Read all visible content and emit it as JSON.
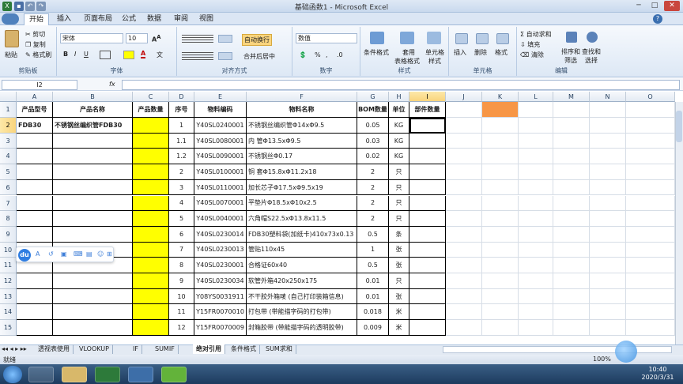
{
  "window": {
    "title": "基础函数1 - Microsoft Excel"
  },
  "ribbon": {
    "tabs": [
      "开始",
      "插入",
      "页面布局",
      "公式",
      "数据",
      "审阅",
      "视图"
    ],
    "active_tab": "开始",
    "clipboard": {
      "paste": "粘贴",
      "cut": "剪切",
      "copy": "复制",
      "format_painter": "格式刷",
      "label": "剪贴板"
    },
    "font": {
      "name": "宋体",
      "size": "10",
      "label": "字体"
    },
    "alignment": {
      "wrap": "自动换行",
      "merge": "合并后居中",
      "label": "对齐方式"
    },
    "number": {
      "format": "数值",
      "label": "数字"
    },
    "styles": {
      "cond": "条件格式",
      "table1": "套用",
      "table2": "表格格式",
      "cell1": "单元格",
      "cell2": "样式",
      "label": "样式"
    },
    "cells": {
      "insert": "插入",
      "delete": "删除",
      "format": "格式",
      "label": "单元格"
    },
    "editing": {
      "autosum": "自动求和",
      "fill": "填充",
      "clear": "清除",
      "sort1": "排序和",
      "sort2": "筛选",
      "find1": "查找和",
      "find2": "选择",
      "label": "编辑"
    }
  },
  "formula_bar": {
    "name_box": "I2",
    "fx": "fx",
    "value": ""
  },
  "columns": [
    "A",
    "B",
    "C",
    "D",
    "E",
    "F",
    "G",
    "H",
    "I",
    "J",
    "K",
    "L",
    "M",
    "N",
    "O"
  ],
  "selected_column": "I",
  "headers": {
    "A": "产品型号",
    "B": "产品名称",
    "C": "产品数量",
    "D": "序号",
    "E": "物料编码",
    "F": "物料名称",
    "G": "BOM数量",
    "H": "单位",
    "I": "部件数量"
  },
  "rows": [
    {
      "n": "2",
      "A": "FDB30",
      "B": "不锈钢丝编织管FDB30",
      "D": "1",
      "E": "Y40SL0240001",
      "F": "不锈钢丝编织管Φ14xΦ9.5",
      "G": "0.05",
      "H": "KG"
    },
    {
      "n": "3",
      "A": "",
      "B": "",
      "D": "1.1",
      "E": "Y40SL0080001",
      "F": "内 管Φ13.5xΦ9.5",
      "G": "0.03",
      "H": "KG"
    },
    {
      "n": "4",
      "A": "",
      "B": "",
      "D": "1.2",
      "E": "Y40SL0090001",
      "F": "不锈钢丝Φ0.17",
      "G": "0.02",
      "H": "KG"
    },
    {
      "n": "5",
      "A": "",
      "B": "",
      "D": "2",
      "E": "Y40SL0100001",
      "F": "铜 套Φ15.8xΦ11.2x18",
      "G": "2",
      "H": "只"
    },
    {
      "n": "6",
      "A": "",
      "B": "",
      "D": "3",
      "E": "Y40SL0110001",
      "F": "加长芯子Φ17.5xΦ9.5x19",
      "G": "2",
      "H": "只"
    },
    {
      "n": "7",
      "A": "",
      "B": "",
      "D": "4",
      "E": "Y40SL0070001",
      "F": "平垫片Φ18.5xΦ10x2.5",
      "G": "2",
      "H": "只"
    },
    {
      "n": "8",
      "A": "",
      "B": "",
      "D": "5",
      "E": "Y40SL0040001",
      "F": "六角帽S22.5xΦ13.8x11.5",
      "G": "2",
      "H": "只"
    },
    {
      "n": "9",
      "A": "",
      "B": "",
      "D": "6",
      "E": "Y40SL0230014",
      "F": "FDB30塑料袋(加纸卡)410x73x0.13",
      "G": "0.5",
      "H": "条"
    },
    {
      "n": "10",
      "A": "",
      "B": "",
      "D": "7",
      "E": "Y40SL0230013",
      "F": "管贴110x45",
      "G": "1",
      "H": "张"
    },
    {
      "n": "11",
      "A": "",
      "B": "",
      "D": "8",
      "E": "Y40SL0230001",
      "F": "合格证60x40",
      "G": "0.5",
      "H": "张"
    },
    {
      "n": "12",
      "A": "",
      "B": "",
      "D": "9",
      "E": "Y40SL0230034",
      "F": "软管外箱420x250x175",
      "G": "0.01",
      "H": "只"
    },
    {
      "n": "13",
      "A": "",
      "B": "",
      "D": "10",
      "E": "Y08YS0031911",
      "F": "不干胶外箱唛 (自己打印装箱信息)",
      "G": "0.01",
      "H": "张"
    },
    {
      "n": "14",
      "A": "",
      "B": "",
      "D": "11",
      "E": "Y15FR0070010",
      "F": "打包带 (带能描字码的打包带)",
      "G": "0.018",
      "H": "米"
    },
    {
      "n": "15",
      "A": "",
      "B": "",
      "D": "12",
      "E": "Y15FR0070009",
      "F": "封箱胶带 (带能描字码的透明胶带)",
      "G": "0.009",
      "H": "米"
    }
  ],
  "sheet_tabs": [
    "透视表使用",
    "VLOOKUP",
    "IF",
    "SUMIF",
    "绝对引用",
    "条件格式",
    "SUM求和"
  ],
  "active_sheet": "绝对引用",
  "status": {
    "mode": "就绪",
    "zoom": "100%"
  },
  "float_toolbar": {
    "logo": "du"
  },
  "taskbar": {
    "time": "10:40",
    "date": "2020/3/31"
  },
  "colors": {
    "yellow": "#ffff00",
    "orange": "#f79646",
    "accent": "#4f81bd"
  }
}
